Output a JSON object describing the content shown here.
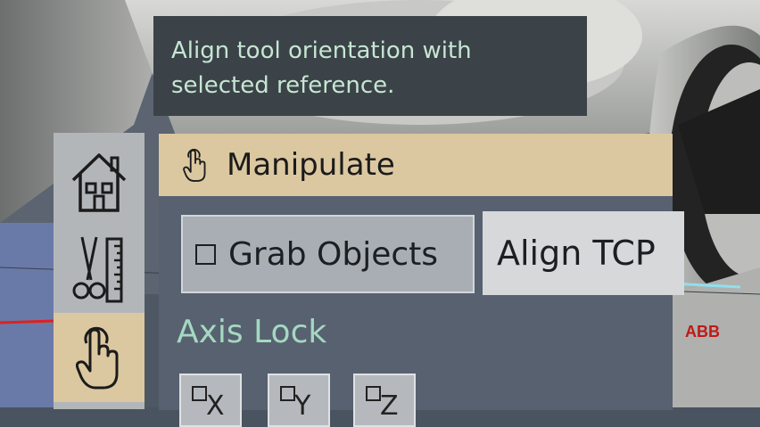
{
  "tooltip": {
    "line1": "Align tool orientation with",
    "line2": "selected reference."
  },
  "sidebar": {
    "items": [
      {
        "name": "home",
        "icon": "house-icon",
        "active": false
      },
      {
        "name": "tools",
        "icon": "scissors-ruler-icon",
        "active": false
      },
      {
        "name": "manipulate",
        "icon": "hand-pointer-icon",
        "active": true
      }
    ]
  },
  "panel": {
    "title": "Manipulate",
    "title_icon": "hand-pointer-icon",
    "grab_objects_label": "Grab Objects",
    "grab_objects_checked": false,
    "align_tcp_label": "Align TCP",
    "axis_lock_title": "Axis Lock",
    "axis_buttons": [
      "X",
      "Y",
      "Z"
    ]
  },
  "scene": {
    "brand_text": "ABB"
  },
  "colors": {
    "accent": "#dcc8a0",
    "tooltip_bg": "#3b4248",
    "tooltip_text": "#c6e6d2",
    "panel_bg": "#576170",
    "axis_lock_text": "#a5d8c1"
  }
}
